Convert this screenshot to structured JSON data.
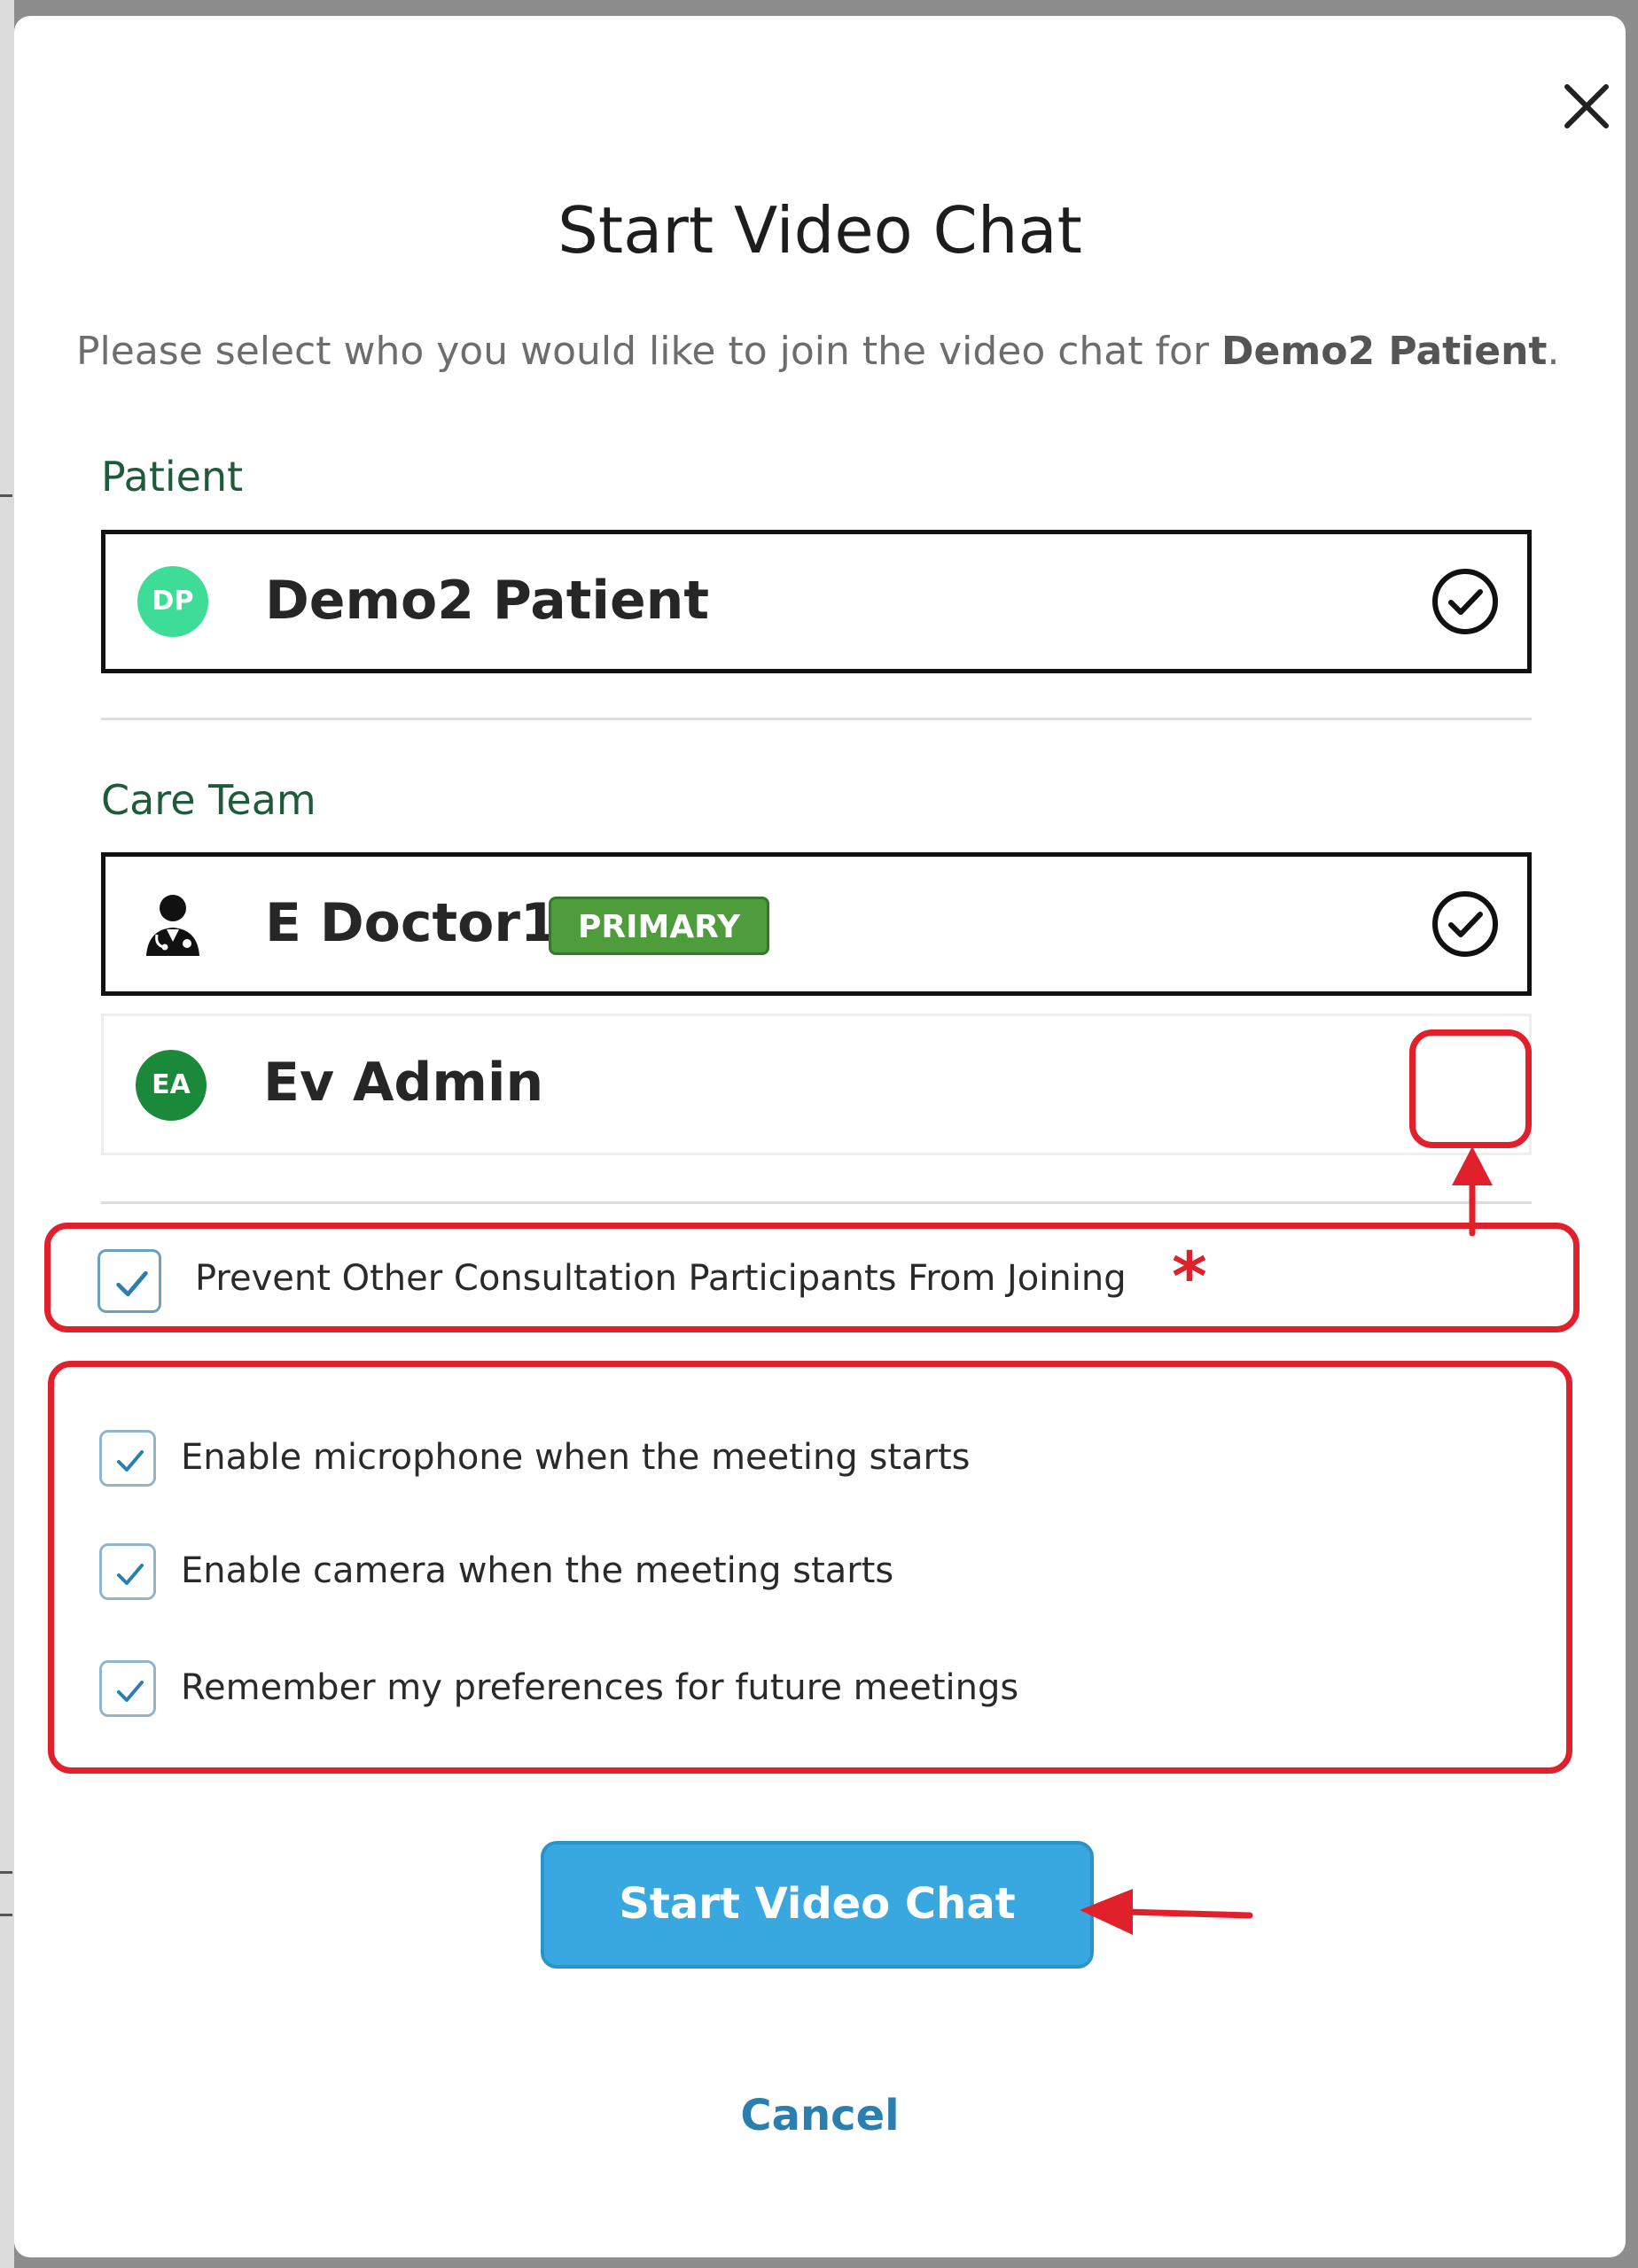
{
  "dialog": {
    "title": "Start Video Chat",
    "subtitle_prefix": "Please select who you would like to join the video chat for",
    "subtitle_patient": "Demo2 Patient",
    "subtitle_suffix": "."
  },
  "patient_section": {
    "label": "Patient",
    "participant": {
      "initials": "DP",
      "name": "Demo2 Patient",
      "selected": true,
      "avatar_color": "#3ddc97"
    }
  },
  "care_team_section": {
    "label": "Care Team",
    "participants": [
      {
        "icon": "doctor-icon",
        "name": "E Doctor1",
        "badge": "PRIMARY",
        "selected": true
      },
      {
        "initials": "EA",
        "name": "Ev Admin",
        "selected": false,
        "avatar_color": "#1a8a3a"
      }
    ]
  },
  "options": {
    "prevent_joining": {
      "label": "Prevent Other Consultation Participants From Joining",
      "checked": true
    },
    "media": [
      {
        "label": "Enable microphone when the meeting starts",
        "checked": true
      },
      {
        "label": "Enable camera when the meeting starts",
        "checked": true
      },
      {
        "label": "Remember my preferences for future meetings",
        "checked": true
      }
    ]
  },
  "annotation": {
    "required_marker": "*",
    "color": "#e0212c"
  },
  "buttons": {
    "start": "Start Video Chat",
    "cancel": "Cancel"
  },
  "colors": {
    "primary_button": "#3aa8e0",
    "section_label": "#1f5b3a",
    "badge": "#4e9c3b"
  }
}
